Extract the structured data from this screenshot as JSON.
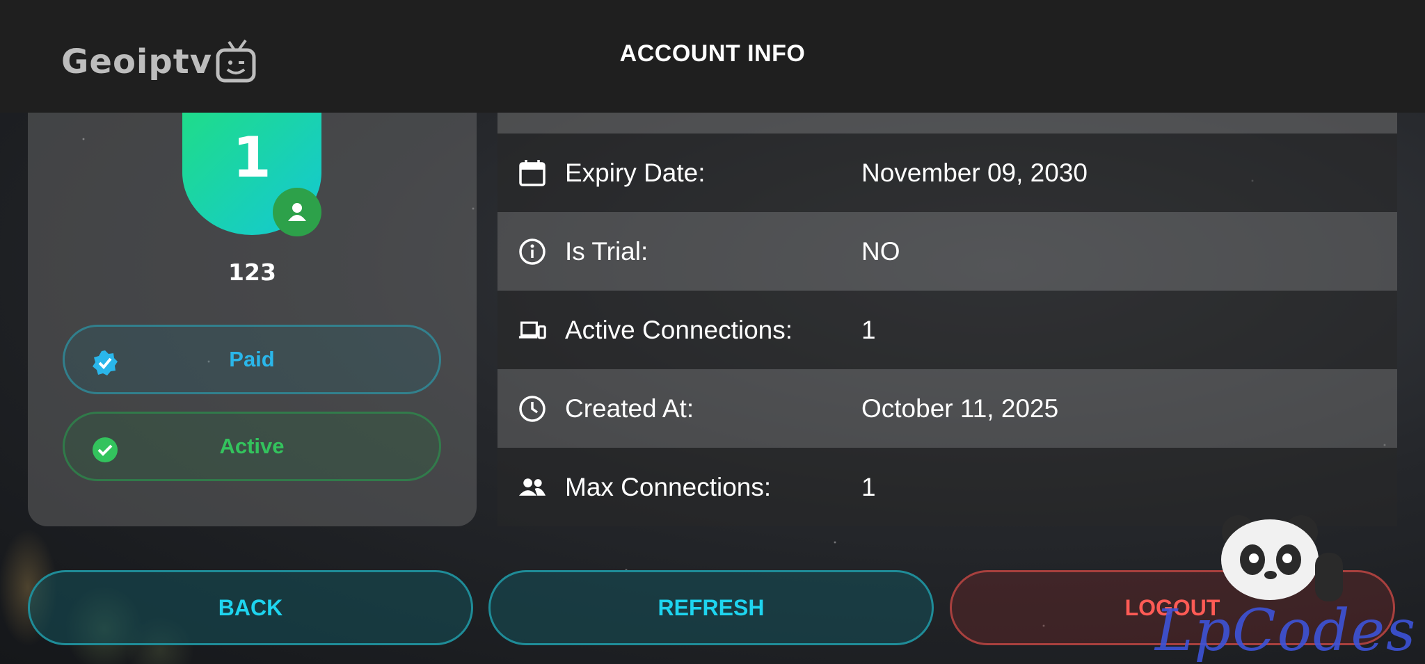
{
  "header": {
    "logo_text": "Geoiptv",
    "title": "ACCOUNT INFO"
  },
  "profile": {
    "avatar_number": "1",
    "username": "123",
    "status_paid": "Paid",
    "status_active": "Active"
  },
  "info_rows": [
    {
      "icon": "calendar-icon",
      "label": "Expiry Date:",
      "value": "November 09, 2030"
    },
    {
      "icon": "info-icon",
      "label": "Is Trial:",
      "value": "NO"
    },
    {
      "icon": "devices-icon",
      "label": "Active Connections:",
      "value": "1"
    },
    {
      "icon": "clock-icon",
      "label": "Created At:",
      "value": "October 11, 2025"
    },
    {
      "icon": "users-icon",
      "label": "Max Connections:",
      "value": "1"
    }
  ],
  "buttons": {
    "back": "BACK",
    "refresh": "REFRESH",
    "logout": "LOGOUT"
  },
  "watermark": "LpCodes",
  "colors": {
    "accent_cyan": "#1ed4ef",
    "paid_blue": "#2ab6ea",
    "active_green": "#33c35d",
    "logout_red": "#ff5b55",
    "avatar_gradient_start": "#1fdc8a",
    "avatar_gradient_end": "#14c8d4"
  }
}
